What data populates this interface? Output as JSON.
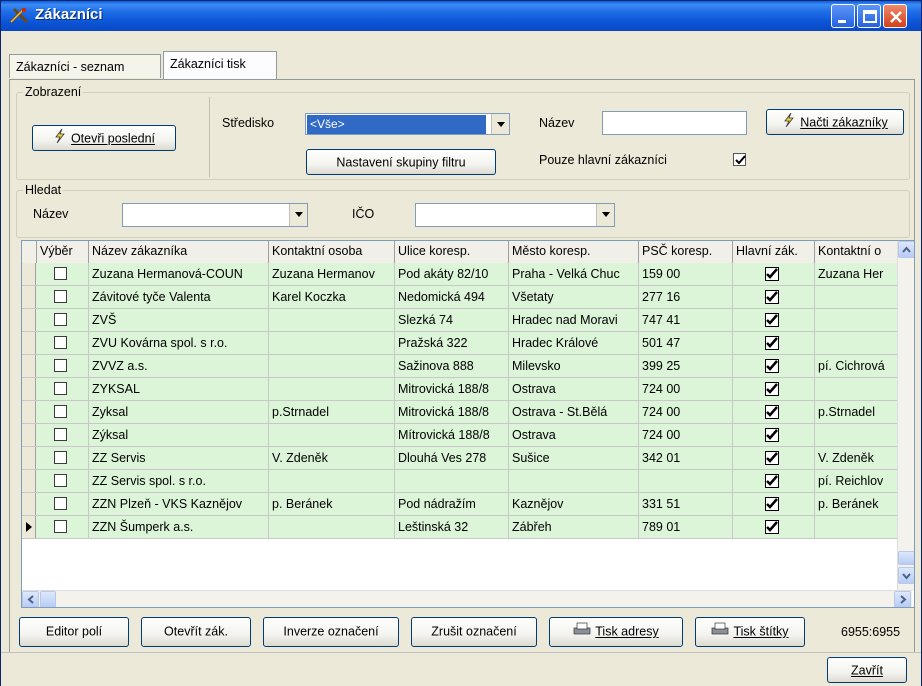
{
  "window": {
    "title": "Zákazníci"
  },
  "tabs": [
    {
      "label": "Zákazníci - seznam"
    },
    {
      "label": "Zákazníci tisk"
    }
  ],
  "display_group": {
    "label": "Zobrazení",
    "open_last_label": "Otevři poslední",
    "center_label": "Středisko",
    "center_value": "<Vše>",
    "filter_settings_label": "Nastavení skupiny filtru",
    "name_label": "Název",
    "name_value": "",
    "load_label": "Načti zákazníky",
    "main_only_label": "Pouze hlavní zákazníci",
    "main_only_checked": true
  },
  "search_group": {
    "label": "Hledat",
    "name_label": "Název",
    "name_value": "",
    "ico_label": "IČO",
    "ico_value": ""
  },
  "table": {
    "columns": [
      "Výběr",
      "Název zákazníka",
      "Kontaktní osoba",
      "Ulice koresp.",
      "Město koresp.",
      "PSČ koresp.",
      "Hlavní zák.",
      "Kontaktní o"
    ],
    "rows": [
      {
        "selected": false,
        "name": "Zuzana Hermanová-COUN",
        "contact": "Zuzana Hermanov",
        "street": "Pod akáty 82/10",
        "city": "Praha - Velká Chuc",
        "zip": "159 00",
        "main": true,
        "contact2": "Zuzana Her"
      },
      {
        "selected": false,
        "name": "Závitové tyče Valenta",
        "contact": "Karel Koczka",
        "street": "Nedomická 494",
        "city": "Všetaty",
        "zip": "277 16",
        "main": true,
        "contact2": ""
      },
      {
        "selected": false,
        "name": "ZVŠ",
        "contact": "",
        "street": "Slezká 74",
        "city": "Hradec nad Moravi",
        "zip": "747 41",
        "main": true,
        "contact2": ""
      },
      {
        "selected": false,
        "name": "ZVU Kovárna spol. s r.o.",
        "contact": "",
        "street": "Pražská 322",
        "city": "Hradec Králové",
        "zip": "501 47",
        "main": true,
        "contact2": ""
      },
      {
        "selected": false,
        "name": "ZVVZ  a.s.",
        "contact": "",
        "street": "Sažinova 888",
        "city": "Milevsko",
        "zip": "399 25",
        "main": true,
        "contact2": "pí. Cichrová"
      },
      {
        "selected": false,
        "name": "ZYKSAL",
        "contact": "",
        "street": "Mitrovická 188/8",
        "city": "Ostrava",
        "zip": "724 00",
        "main": true,
        "contact2": ""
      },
      {
        "selected": false,
        "name": "Zyksal",
        "contact": "p.Strnadel",
        "street": "Mitrovická 188/8",
        "city": "Ostrava - St.Bělá",
        "zip": "724 00",
        "main": true,
        "contact2": "p.Strnadel"
      },
      {
        "selected": false,
        "name": "Zýksal",
        "contact": "",
        "street": "Mítrovická 188/8",
        "city": "Ostrava",
        "zip": "724 00",
        "main": true,
        "contact2": ""
      },
      {
        "selected": false,
        "name": "ZZ Servis",
        "contact": "V. Zdeněk",
        "street": "Dlouhá Ves 278",
        "city": "Sušice",
        "zip": "342 01",
        "main": true,
        "contact2": "V. Zdeněk"
      },
      {
        "selected": false,
        "name": "ZZ Servis spol. s r.o.",
        "contact": "",
        "street": "",
        "city": "",
        "zip": "",
        "main": true,
        "contact2": "pí. Reichlov"
      },
      {
        "selected": false,
        "name": "ZZN Plzeň - VKS Kaznějov",
        "contact": "p. Beránek",
        "street": "Pod nádražím",
        "city": "Kaznějov",
        "zip": "331 51",
        "main": true,
        "contact2": "p. Beránek"
      },
      {
        "selected": false,
        "name": "ZZN Šumperk a.s.",
        "contact": "",
        "street": "Leštinská 32",
        "city": "Zábřeh",
        "zip": "789 01",
        "main": true,
        "contact2": ""
      }
    ]
  },
  "footer": {
    "field_editor": "Editor polí",
    "open_customer": "Otevřít zák.",
    "invert": "Inverze označení",
    "clear": "Zrušit označení",
    "print_address": "Tisk adresy",
    "print_labels": "Tisk štítky",
    "count": "6955:6955",
    "close": "Zavřít"
  }
}
